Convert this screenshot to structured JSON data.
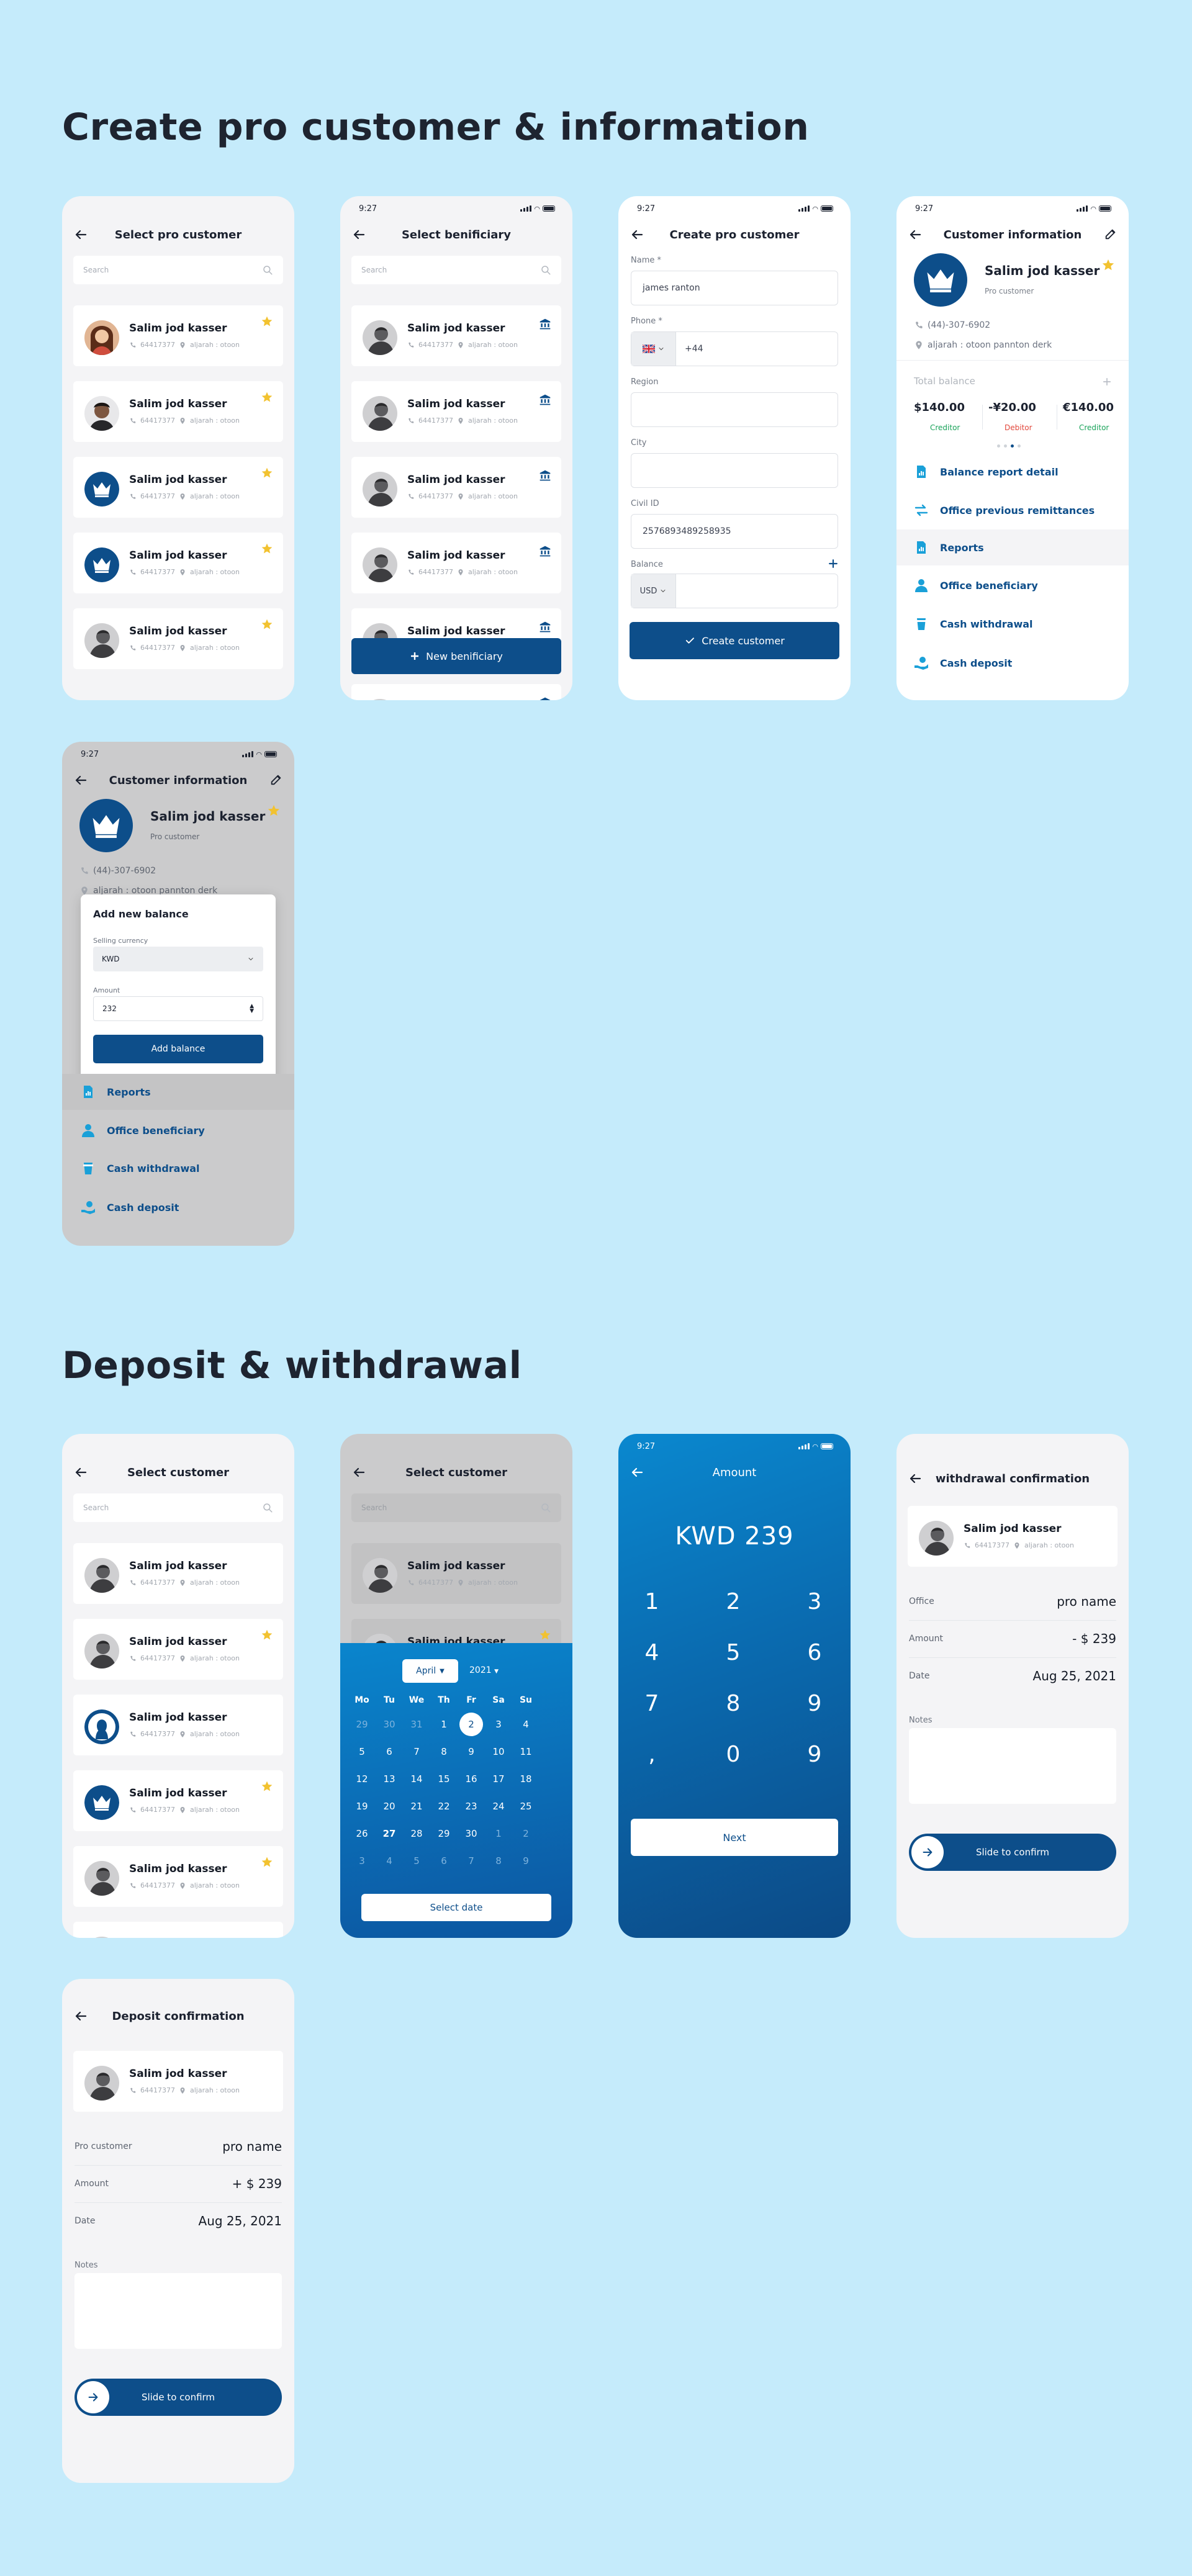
{
  "sections": {
    "s1": "Create pro customer & information",
    "s2": "Deposit & withdrawal"
  },
  "status_time": "9:27",
  "search_placeholder": "Search",
  "customer": {
    "name": "Salim jod kasser",
    "phone": "64417377",
    "location": "aljarah : otoon"
  },
  "s_pro": {
    "title": "Select pro customer"
  },
  "s_ben": {
    "title": "Select benificiary",
    "button": "New benificiary"
  },
  "s_create": {
    "title": "Create pro customer",
    "name_label": "Name *",
    "name_value": "james ranton",
    "phone_label": "Phone *",
    "phone_code": "+44",
    "region_label": "Region",
    "city_label": "City",
    "civil_label": "Civil ID",
    "civil_value": "2576893489258935",
    "balance_label": "Balance",
    "currency": "USD",
    "button": "Create customer"
  },
  "s_info": {
    "title": "Customer information",
    "type": "Pro customer",
    "phone": "(44)-307-6902",
    "address": "aljarah : otoon pannton derk",
    "total_label": "Total balance",
    "balances": [
      {
        "amount": "$140.00",
        "status": "Creditor",
        "color": "#1aa35a"
      },
      {
        "amount": "-¥20.00",
        "status": "Debitor",
        "color": "#e2473b"
      },
      {
        "amount": "€140.00",
        "status": "Creditor",
        "color": "#1aa35a"
      }
    ],
    "menu": [
      "Balance report detail",
      "Office previous remittances",
      "Reports",
      "Office beneficiary",
      "Cash withdrawal",
      "Cash deposit"
    ]
  },
  "s_modal": {
    "title": "Add new balance",
    "sell_label": "Selling currency",
    "sell_value": "KWD",
    "amount_label": "Amount",
    "amount_value": "232",
    "button": "Add balance",
    "address_partial": "aljarah : otoon pannton derk"
  },
  "s_sel": {
    "title": "Select customer"
  },
  "s_cal": {
    "month": "April",
    "year": "2021",
    "weekdays": [
      "Mo",
      "Tu",
      "We",
      "Th",
      "Fr",
      "Sa",
      "Su"
    ],
    "weeks": [
      [
        "29",
        "30",
        "31",
        "1",
        "2",
        "3",
        "4"
      ],
      [
        "5",
        "6",
        "7",
        "8",
        "9",
        "10",
        "11"
      ],
      [
        "12",
        "13",
        "14",
        "15",
        "16",
        "17",
        "18"
      ],
      [
        "19",
        "20",
        "21",
        "22",
        "23",
        "24",
        "25"
      ],
      [
        "26",
        "27",
        "28",
        "29",
        "30",
        "1",
        "2"
      ],
      [
        "3",
        "4",
        "5",
        "6",
        "7",
        "8",
        "9"
      ]
    ],
    "selected": "2",
    "button": "Select date"
  },
  "s_amount": {
    "title": "Amount",
    "value": "KWD 239",
    "keys": [
      "1",
      "2",
      "3",
      "4",
      "5",
      "6",
      "7",
      "8",
      "9",
      ",",
      "0",
      "9"
    ],
    "button": "Next"
  },
  "s_withdraw": {
    "title": "withdrawal confirmation",
    "office_label": "Office",
    "office_value": "pro name",
    "amount_label": "Amount",
    "amount_value": "- $ 239",
    "date_label": "Date",
    "date_value": "Aug 25, 2021",
    "notes_label": "Notes",
    "slide": "Slide to confirm"
  },
  "s_deposit": {
    "title": "Deposit confirmation",
    "office_label": "Pro customer",
    "office_value": "pro name",
    "amount_label": "Amount",
    "amount_value": "+ $ 239",
    "date_label": "Date",
    "date_value": "Aug 25, 2021",
    "notes_label": "Notes",
    "slide": "Slide to confirm"
  },
  "colors": {
    "background": "#c5ebfb",
    "primary": "#0d4e8a",
    "accent": "#1aa0d8",
    "star": "#f2c230",
    "creditor": "#1aa35a",
    "debitor": "#e2473b"
  }
}
